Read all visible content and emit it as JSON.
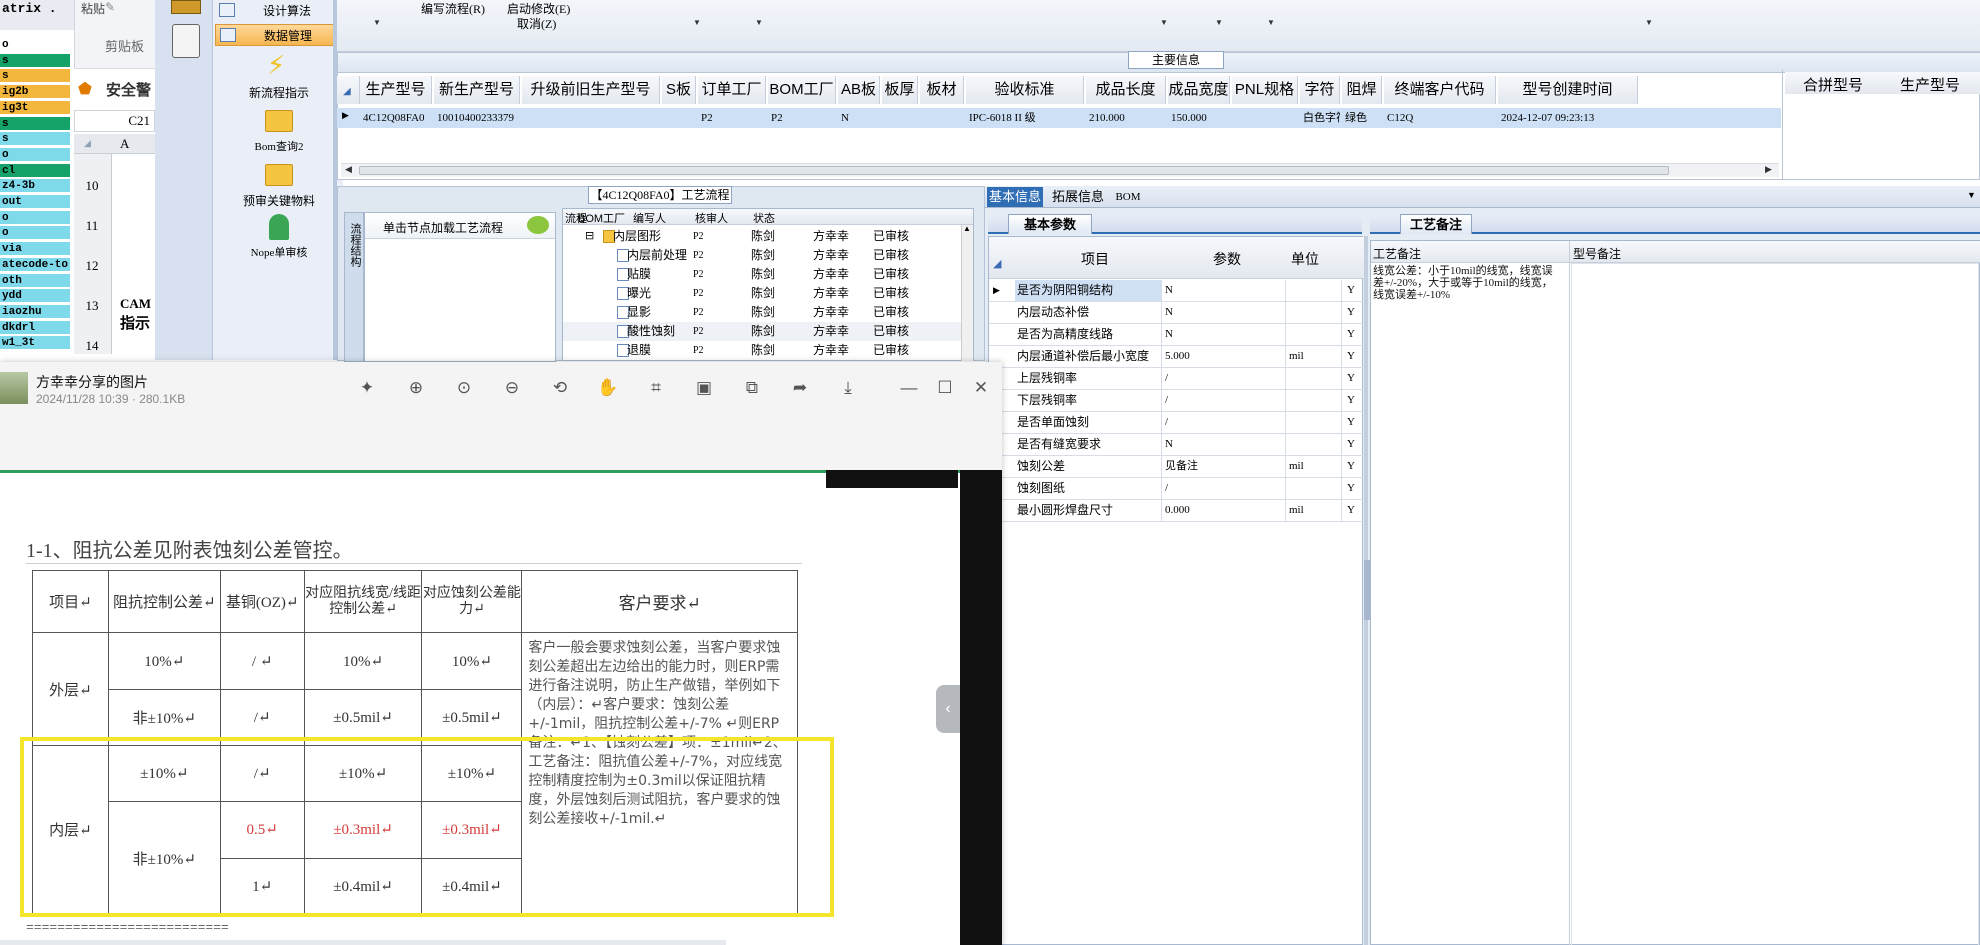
{
  "excel": {
    "name_box": "C21",
    "row_items": [
      "o",
      "s",
      "s",
      "ig2b",
      "ig3t",
      "s",
      "s",
      "o",
      "cl",
      "z4-3b",
      "out",
      "o",
      "o",
      "via",
      "atecode-to",
      "oth",
      "ydd",
      "iaozhu",
      "dkdrl",
      "w1_3t"
    ],
    "row_numbers": [
      "10",
      "11",
      "12",
      "13",
      "14"
    ],
    "col_header": "A",
    "security_label": "安全警",
    "clipboard_label": "剪贴板",
    "matrix_label": "atrix .",
    "paste_label": "粘贴",
    "cam_text": "CAM",
    "cam_text2": "指示"
  },
  "left_ribbon": {
    "items": [
      "设计算法",
      "数据管理",
      "新流程指示",
      "Bom查询2",
      "预审关键物料",
      "Nope单审核"
    ]
  },
  "toolbar": {
    "edit_flow": "编写流程(R)",
    "start_modify": "启动修改(E)",
    "cancel": "取消(Z)"
  },
  "main_info": {
    "title": "主要信息",
    "columns": [
      "生产型号",
      "新生产型号",
      "升级前旧生产型号",
      "S板",
      "订单工厂",
      "BOM工厂",
      "AB板",
      "板厚",
      "板材",
      "验收标准",
      "成品长度",
      "成品宽度",
      "PNL规格",
      "字符",
      "阻焊",
      "终端客户代码",
      "型号创建时间"
    ],
    "row": [
      "4C12Q08FA0",
      "10010400233379",
      "",
      "",
      "P2",
      "P2",
      "N",
      "",
      "",
      "IPC-6018 II 级",
      "210.000",
      "150.000",
      "",
      "白色字符",
      "绿色",
      "C12Q",
      "2024-12-07 09:23:13"
    ],
    "right_columns": [
      "合拼型号",
      "生产型号"
    ]
  },
  "process": {
    "title": "【4C12Q08FA0】工艺流程",
    "side_tab": "流程结构",
    "load_btn": "单击节点加载工艺流程",
    "columns": [
      "流程",
      "BOM工厂",
      "编写人",
      "核审人",
      "状态"
    ],
    "rows": [
      {
        "name": "内层图形",
        "bom": "P2",
        "writer": "陈剑",
        "checker": "方幸幸",
        "status": "已审核"
      },
      {
        "name": "内层前处理",
        "bom": "P2",
        "writer": "陈剑",
        "checker": "方幸幸",
        "status": "已审核"
      },
      {
        "name": "贴膜",
        "bom": "P2",
        "writer": "陈剑",
        "checker": "方幸幸",
        "status": "已审核"
      },
      {
        "name": "曝光",
        "bom": "P2",
        "writer": "陈剑",
        "checker": "方幸幸",
        "status": "已审核"
      },
      {
        "name": "显影",
        "bom": "P2",
        "writer": "陈剑",
        "checker": "方幸幸",
        "status": "已审核"
      },
      {
        "name": "酸性蚀刻",
        "bom": "P2",
        "writer": "陈剑",
        "checker": "方幸幸",
        "status": "已审核"
      },
      {
        "name": "退膜",
        "bom": "P2",
        "writer": "陈剑",
        "checker": "方幸幸",
        "status": "已审核"
      }
    ]
  },
  "basic_info": {
    "tabs": [
      "基本信息",
      "拓展信息",
      "BOM"
    ],
    "subtab": "基本参数",
    "columns": [
      "项目",
      "参数",
      "单位"
    ],
    "rows": [
      {
        "item": "是否为阴阳铜结构",
        "param": "N",
        "unit": "",
        "flag": "Y"
      },
      {
        "item": "内层动态补偿",
        "param": "N",
        "unit": "",
        "flag": "Y"
      },
      {
        "item": "是否为高精度线路",
        "param": "N",
        "unit": "",
        "flag": "Y"
      },
      {
        "item": "内层通道补偿后最小宽度",
        "param": "5.000",
        "unit": "mil",
        "flag": "Y"
      },
      {
        "item": "上层残铜率",
        "param": "/",
        "unit": "",
        "flag": "Y"
      },
      {
        "item": "下层残铜率",
        "param": "/",
        "unit": "",
        "flag": "Y"
      },
      {
        "item": "是否单面蚀刻",
        "param": "/",
        "unit": "",
        "flag": "Y"
      },
      {
        "item": "是否有缝宽要求",
        "param": "N",
        "unit": "",
        "flag": "Y"
      },
      {
        "item": "蚀刻公差",
        "param": "见备注",
        "unit": "mil",
        "flag": "Y"
      },
      {
        "item": "蚀刻图纸",
        "param": "/",
        "unit": "",
        "flag": "Y"
      },
      {
        "item": "最小圆形焊盘尺寸",
        "param": "0.000",
        "unit": "mil",
        "flag": "Y"
      }
    ]
  },
  "remark": {
    "tab": "工艺备注",
    "col1": "工艺备注",
    "col2": "型号备注",
    "text": "线宽公差：小于10mil的线宽，线宽误差+/-20%，大于或等于10mil的线宽，线宽误差+/-10%"
  },
  "viewer": {
    "title": "方幸幸分享的图片",
    "meta": "2024/11/28 10:39 · 280.1KB",
    "heading": "1-1、阻抗公差见附表蚀刻公差管控。",
    "table": {
      "headers": [
        "项目↵",
        "阻抗控制公差↵",
        "基铜(OZ)↵",
        "对应阻抗线宽/线距控制公差↵",
        "对应蚀刻公差能力↵",
        "客户要求↵"
      ],
      "outer": "外层↵",
      "inner": "内层↵",
      "r1": [
        "10%↵",
        "/ ↵",
        "10%↵",
        "10%↵"
      ],
      "r2": [
        "非±10%↵",
        "/↵",
        "±0.5mil↵",
        "±0.5mil↵"
      ],
      "r3": [
        "±10%↵",
        "/↵",
        "±10%↵",
        "±10%↵"
      ],
      "r4_tol": "非±10%↵",
      "r4": [
        "0.5↵",
        "±0.3mil↵",
        "±0.3mil↵"
      ],
      "r5": [
        "1↵",
        "±0.4mil↵",
        "±0.4mil↵"
      ],
      "customer_text": "客户一般会要求蚀刻公差，当客户要求蚀刻公差超出左边给出的能力时，则ERP需进行备注说明，防止生产做错，举例如下（内层）：↵客户要求：蚀刻公差+/-1mil，阻抗控制公差+/-7% ↵则ERP备注：↵1、【蚀刻公差】项：±1mil↵2、工艺备注：阻抗值公差+/-7%，对应线宽控制精度控制为±0.3mil以保证阻抗精度，外层蚀刻后测试阻抗，客户要求的蚀刻公差接收+/-1mil.↵"
    },
    "footer": "=========================="
  }
}
